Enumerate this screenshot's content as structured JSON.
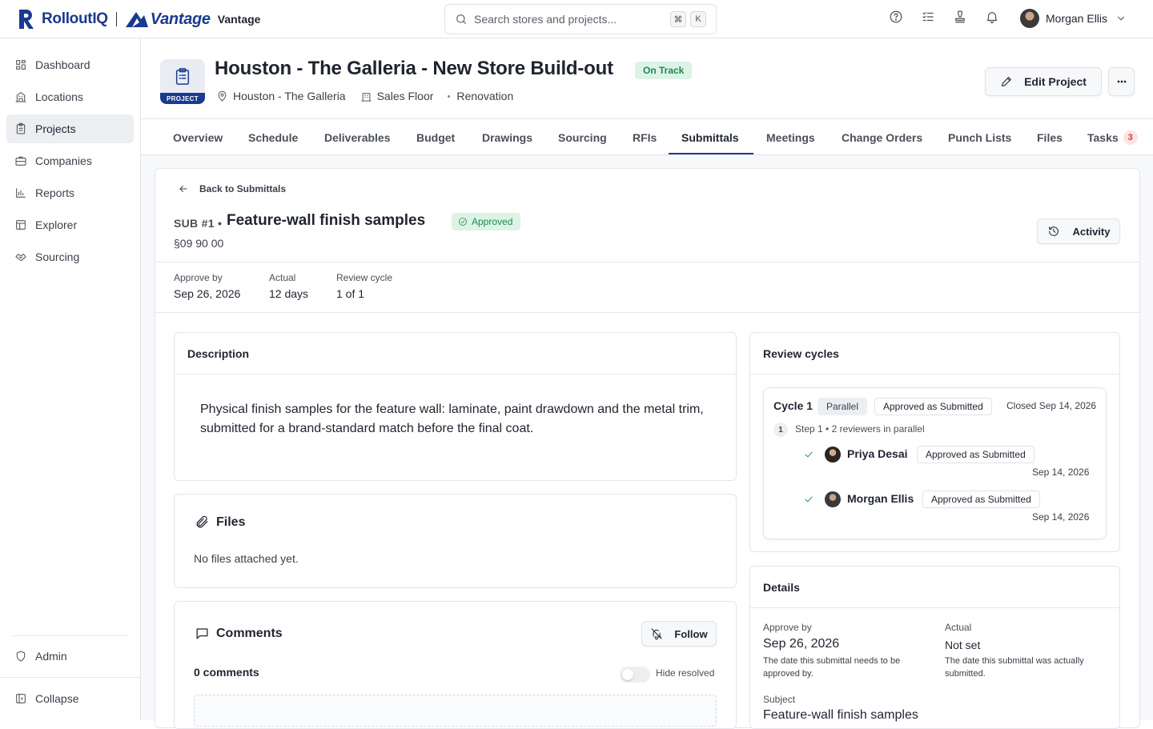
{
  "brand": {
    "name": "RolloutIQ",
    "partner": "Vantage",
    "partner_label": "Vantage"
  },
  "search": {
    "placeholder": "Search stores and projects...",
    "key1": "⌘",
    "key2": "K"
  },
  "user": {
    "name": "Morgan Ellis"
  },
  "sidebar": {
    "items": [
      {
        "label": "Dashboard",
        "icon": "grid-icon"
      },
      {
        "label": "Locations",
        "icon": "building-icon"
      },
      {
        "label": "Projects",
        "icon": "clipboard-icon",
        "active": true
      },
      {
        "label": "Companies",
        "icon": "briefcase-icon"
      },
      {
        "label": "Reports",
        "icon": "bar-chart-icon"
      },
      {
        "label": "Explorer",
        "icon": "table-icon"
      },
      {
        "label": "Sourcing",
        "icon": "handshake-icon"
      }
    ],
    "admin": "Admin",
    "collapse": "Collapse"
  },
  "project": {
    "tag": "PROJECT",
    "title": "Houston - The Galleria - New Store Build-out",
    "status": "On Track",
    "location": "Houston - The Galleria",
    "area": "Sales Floor",
    "type": "Renovation",
    "edit_label": "Edit Project"
  },
  "tabs": [
    {
      "label": "Overview"
    },
    {
      "label": "Schedule"
    },
    {
      "label": "Deliverables"
    },
    {
      "label": "Budget"
    },
    {
      "label": "Drawings"
    },
    {
      "label": "Sourcing"
    },
    {
      "label": "RFIs"
    },
    {
      "label": "Submittals",
      "active": true
    },
    {
      "label": "Meetings"
    },
    {
      "label": "Change Orders"
    },
    {
      "label": "Punch Lists"
    },
    {
      "label": "Files"
    },
    {
      "label": "Tasks",
      "badge": "3"
    }
  ],
  "submittal": {
    "back_label": "Back to Submittals",
    "code": "SUB #1 •",
    "title": "Feature-wall finish samples",
    "status": "Approved",
    "spec": "§09 90 00",
    "activity_label": "Activity",
    "stats": [
      {
        "label": "Approve by",
        "value": "Sep 26, 2026"
      },
      {
        "label": "Actual",
        "value": "12 days"
      },
      {
        "label": "Review cycle",
        "value": "1 of 1"
      }
    ]
  },
  "description": {
    "heading": "Description",
    "text": "Physical finish samples for the feature wall: laminate, paint drawdown and the metal trim, submitted for a brand-standard match before the final coat."
  },
  "files": {
    "heading": "Files",
    "empty": "No files attached yet."
  },
  "comments": {
    "heading": "Comments",
    "follow_label": "Follow",
    "count": "0 comments",
    "hide_resolved": "Hide resolved"
  },
  "review_cycles": {
    "heading": "Review cycles",
    "cycle": {
      "name": "Cycle 1",
      "mode": "Parallel",
      "outcome": "Approved as Submitted",
      "closed": "Closed Sep 14, 2026",
      "step_number": "1",
      "step_text": "Step 1 • 2 reviewers in parallel",
      "reviewers": [
        {
          "name": "Priya Desai",
          "status": "Approved as Submitted",
          "date": "Sep 14, 2026"
        },
        {
          "name": "Morgan Ellis",
          "status": "Approved as Submitted",
          "date": "Sep 14, 2026"
        }
      ]
    }
  },
  "details": {
    "heading": "Details",
    "approve_by_label": "Approve by",
    "approve_by_value": "Sep 26, 2026",
    "approve_by_help": "The date this submittal needs to be approved by.",
    "actual_label": "Actual",
    "actual_value": "Not set",
    "actual_help": "The date this submittal was actually submitted.",
    "subject_label": "Subject",
    "subject_value": "Feature-wall finish samples"
  },
  "colors": {
    "brand": "#1a3a8f",
    "success": "#1f8a4f",
    "success_bg": "#dcf3e6",
    "danger": "#d23c3c"
  }
}
